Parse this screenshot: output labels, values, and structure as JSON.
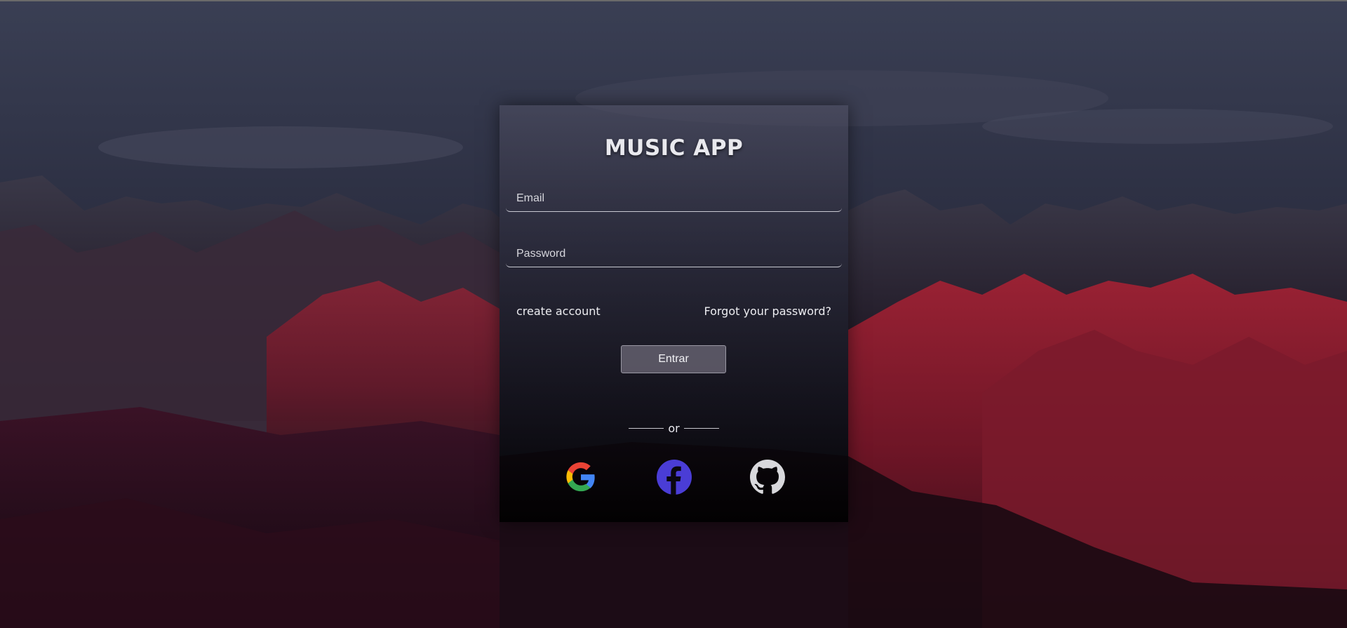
{
  "app": {
    "title": "MUSIC APP"
  },
  "form": {
    "email_placeholder": "Email",
    "email_value": "",
    "password_placeholder": "Password",
    "password_value": "",
    "create_account_label": "create account",
    "forgot_password_label": "Forgot your password?",
    "submit_label": "Entrar",
    "divider_label": "or"
  },
  "social": [
    {
      "icon": "google-icon"
    },
    {
      "icon": "facebook-icon"
    },
    {
      "icon": "github-icon"
    }
  ],
  "colors": {
    "facebook": "#4a3dd6",
    "github": "#d8d8dc",
    "google_red": "#ea4335",
    "google_yellow": "#fbbc05",
    "google_green": "#34a853",
    "google_blue": "#4285f4",
    "mountain_red": "#8a1c2e"
  }
}
